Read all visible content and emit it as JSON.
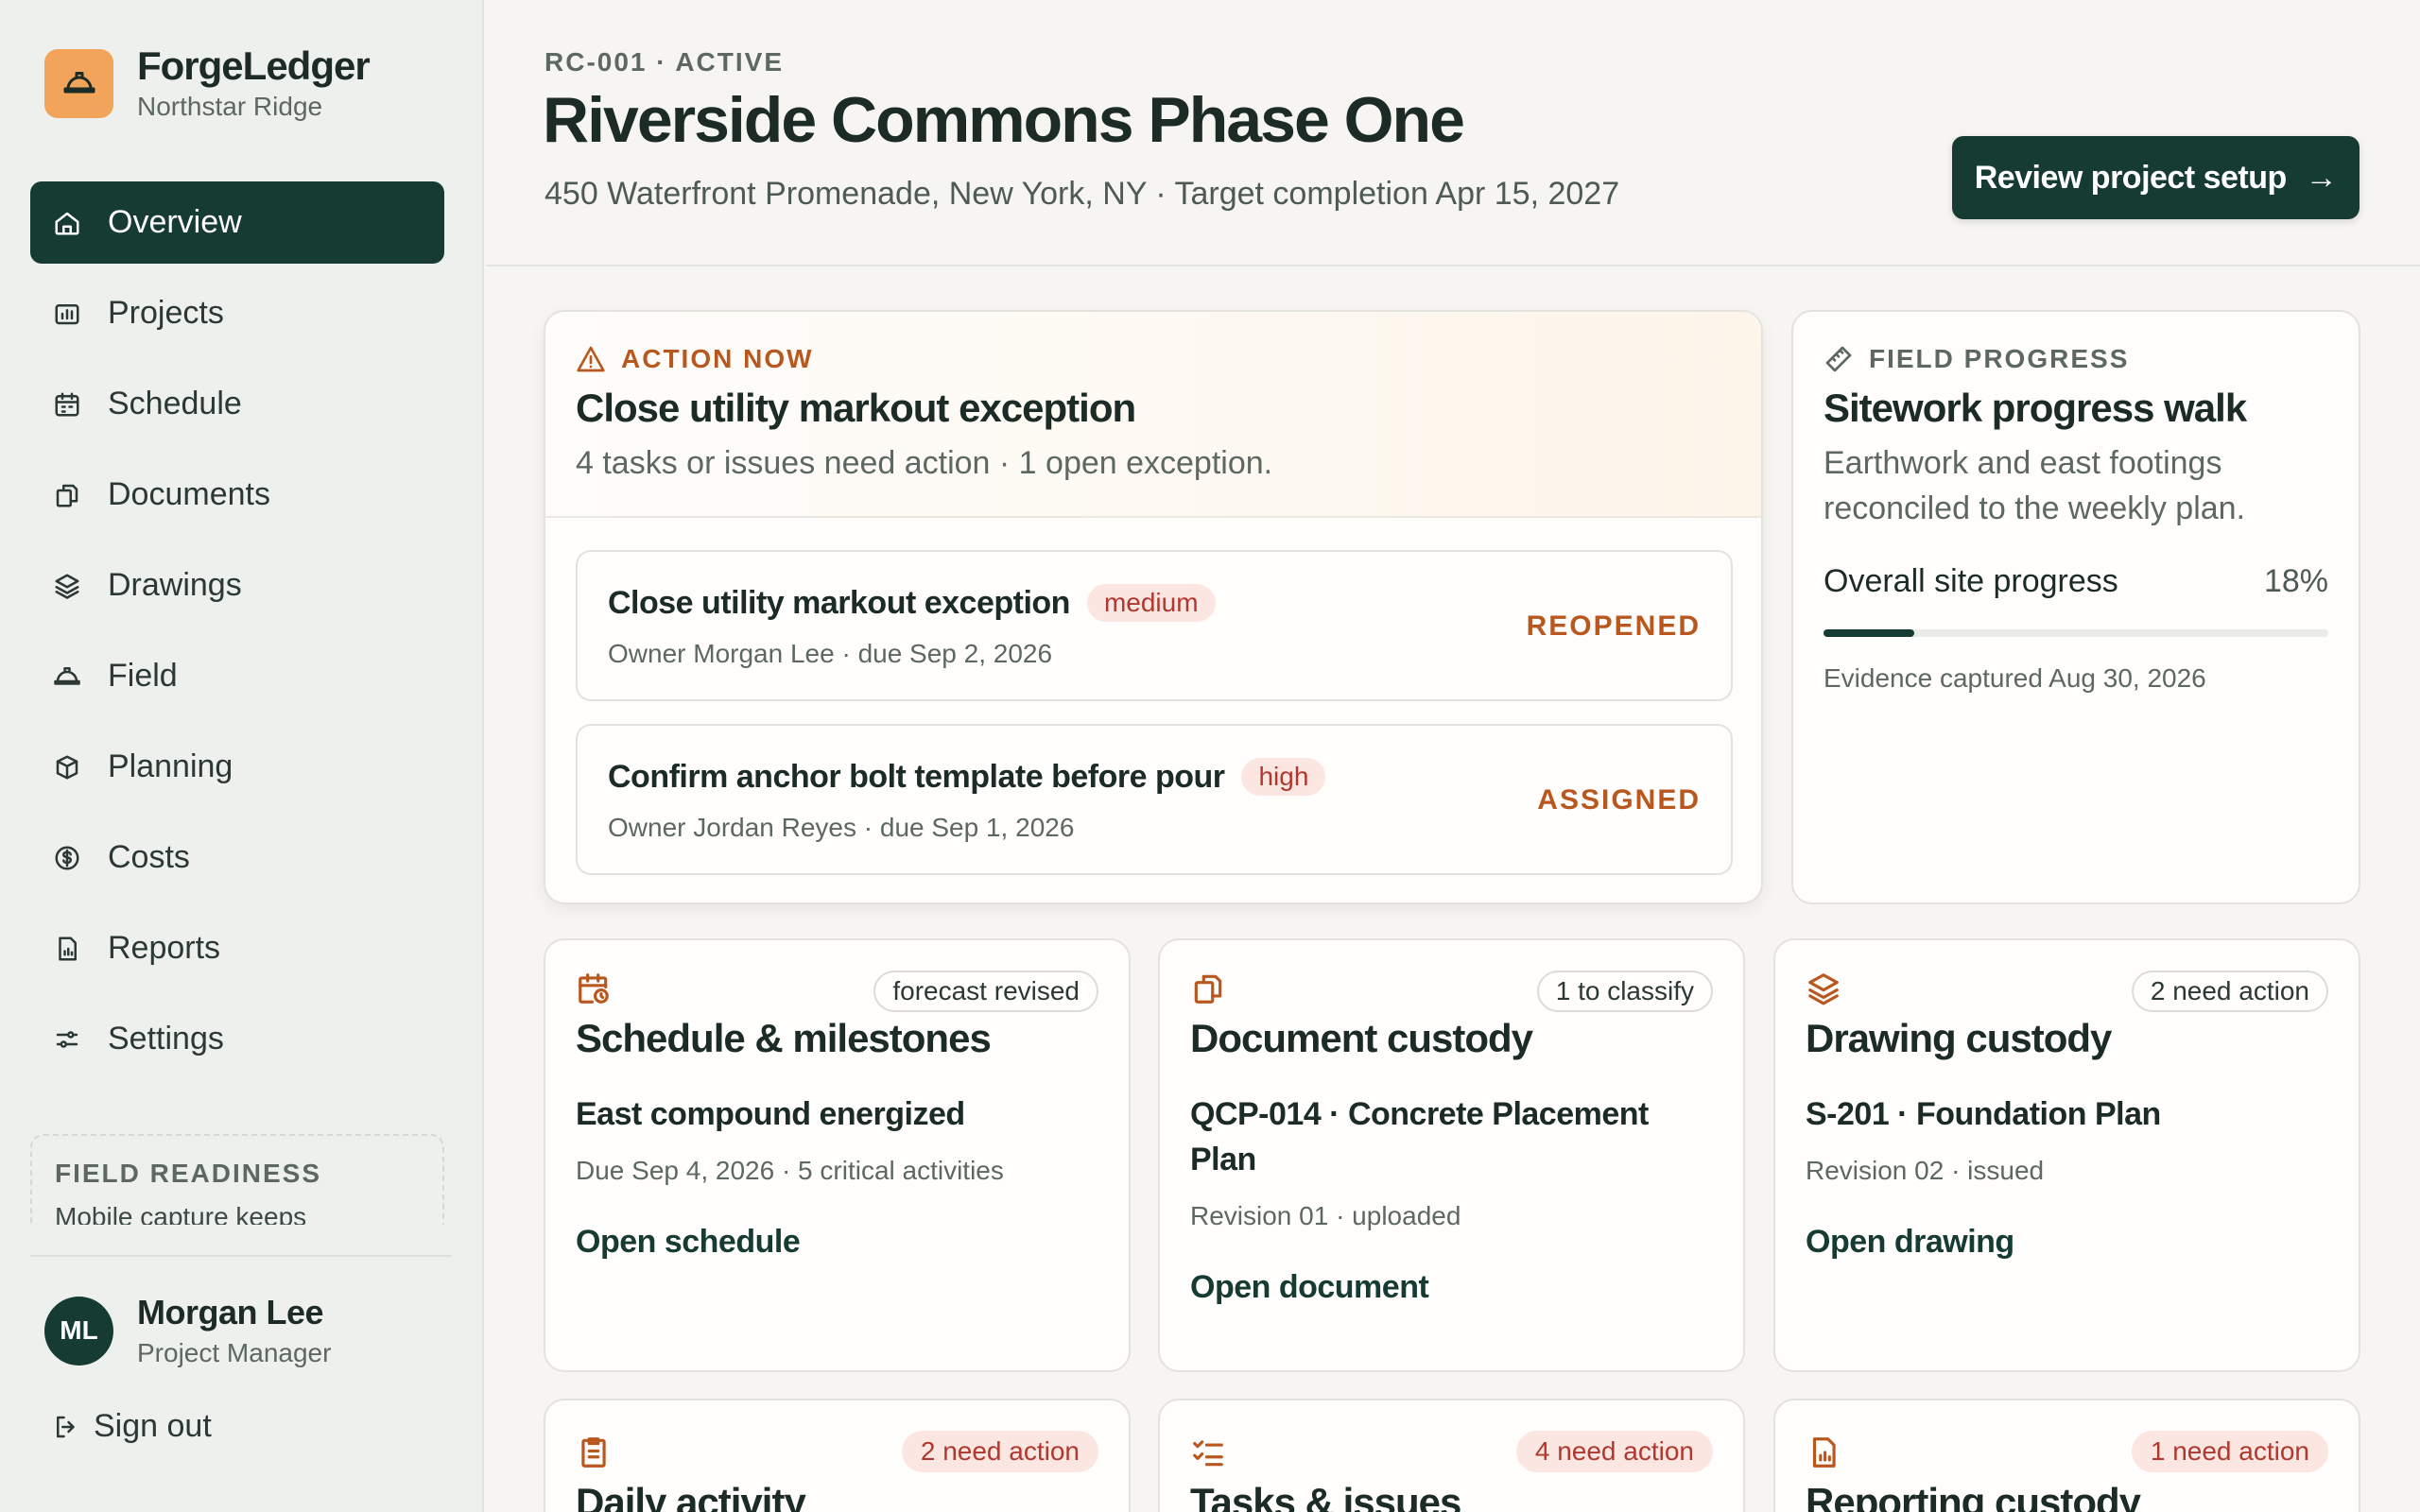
{
  "brand": {
    "name": "ForgeLedger",
    "org": "Northstar Ridge",
    "logo_icon": "hard-hat-icon",
    "logo_color": "#f2a55a"
  },
  "sidebar": {
    "items": [
      {
        "label": "Overview",
        "icon": "home-icon",
        "active": true
      },
      {
        "label": "Projects",
        "icon": "chart-board-icon"
      },
      {
        "label": "Schedule",
        "icon": "calendar-icon"
      },
      {
        "label": "Documents",
        "icon": "documents-icon"
      },
      {
        "label": "Drawings",
        "icon": "layers-icon"
      },
      {
        "label": "Field",
        "icon": "hard-hat-icon"
      },
      {
        "label": "Planning",
        "icon": "package-icon"
      },
      {
        "label": "Costs",
        "icon": "dollar-circle-icon"
      },
      {
        "label": "Reports",
        "icon": "report-icon"
      },
      {
        "label": "Settings",
        "icon": "sliders-icon"
      }
    ],
    "readiness": {
      "title": "FIELD READINESS",
      "text": "Mobile capture keeps"
    },
    "user": {
      "initials": "ML",
      "name": "Morgan Lee",
      "role": "Project Manager"
    },
    "signout_label": "Sign out"
  },
  "header": {
    "eyebrow": "RC-001 · ACTIVE",
    "title": "Riverside Commons Phase One",
    "subtitle": "450 Waterfront Promenade, New York, NY · Target completion Apr 15, 2027",
    "cta_label": "Review project setup",
    "cta_arrow": "→"
  },
  "action": {
    "kicker": "ACTION NOW",
    "title": "Close utility markout exception",
    "desc": "4 tasks or issues need action · 1 open exception.",
    "tasks": [
      {
        "title": "Close utility markout exception",
        "priority": "medium",
        "meta": "Owner Morgan Lee · due Sep 2, 2026",
        "status": "REOPENED"
      },
      {
        "title": "Confirm anchor bolt template before pour",
        "priority": "high",
        "meta": "Owner Jordan Reyes · due Sep 1, 2026",
        "status": "ASSIGNED"
      }
    ]
  },
  "progress": {
    "kicker": "FIELD PROGRESS",
    "title": "Sitework progress walk",
    "desc": "Earthwork and east footings reconciled to the weekly plan.",
    "label": "Overall site progress",
    "value_text": "18%",
    "value": 0.18,
    "evidence": "Evidence captured Aug 30, 2026"
  },
  "modules": [
    {
      "icon": "calendar-clock-icon",
      "badge": "forecast revised",
      "title": "Schedule & milestones",
      "item": "East compound energized",
      "meta": "Due Sep 4, 2026 · 5 critical activities",
      "link": "Open schedule"
    },
    {
      "icon": "documents-icon",
      "badge": "1 to classify",
      "title": "Document custody",
      "item": "QCP-014 · Concrete Placement Plan",
      "meta": "Revision 01 · uploaded",
      "link": "Open document"
    },
    {
      "icon": "layers-icon",
      "badge": "2 need action",
      "title": "Drawing custody",
      "item": "S-201 · Foundation Plan",
      "meta": "Revision 02 · issued",
      "link": "Open drawing"
    }
  ],
  "bottom_modules": [
    {
      "icon": "clipboard-icon",
      "badge": "2 need action",
      "title": "Daily activity"
    },
    {
      "icon": "checklist-icon",
      "badge": "4 need action",
      "title": "Tasks & issues"
    },
    {
      "icon": "report-icon",
      "badge": "1 need action",
      "title": "Reporting custody"
    }
  ],
  "colors": {
    "primary": "#163b33",
    "accent_orange": "#b8581e",
    "danger": "#b1382f",
    "danger_bg": "#fbe6e2"
  }
}
